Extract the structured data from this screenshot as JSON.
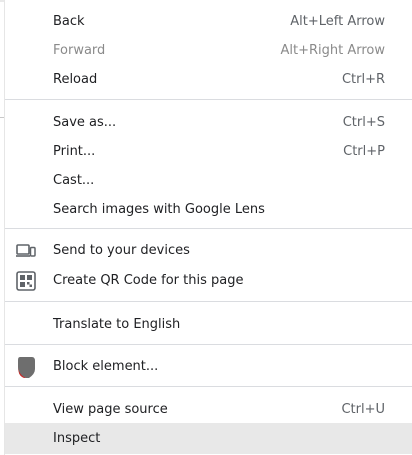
{
  "context_menu": {
    "items": [
      {
        "label": "Back",
        "shortcut": "Alt+Left Arrow"
      },
      {
        "label": "Forward",
        "shortcut": "Alt+Right Arrow",
        "disabled": true
      },
      {
        "label": "Reload",
        "shortcut": "Ctrl+R"
      },
      {
        "label": "Save as...",
        "shortcut": "Ctrl+S"
      },
      {
        "label": "Print...",
        "shortcut": "Ctrl+P"
      },
      {
        "label": "Cast..."
      },
      {
        "label": "Search images with Google Lens"
      },
      {
        "label": "Send to your devices",
        "icon": "devices-icon"
      },
      {
        "label": "Create QR Code for this page",
        "icon": "qr-code-icon"
      },
      {
        "label": "Translate to English"
      },
      {
        "label": "Block element...",
        "icon": "block-element-icon"
      },
      {
        "label": "View page source",
        "shortcut": "Ctrl+U"
      },
      {
        "label": "Inspect",
        "highlighted": true
      }
    ]
  },
  "colors": {
    "text": "#202124",
    "shortcut_text": "#5f6368",
    "disabled_text": "#8a8a8a",
    "separator": "#dadce0",
    "highlight": "#e8e8e8",
    "icon_gray": "#5f6368",
    "block_icon_gray": "#6e6e6e",
    "block_icon_red": "#c62828"
  }
}
